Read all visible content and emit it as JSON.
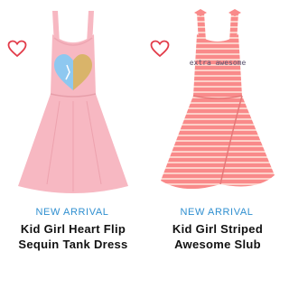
{
  "products": [
    {
      "badge": "NEW ARRIVAL",
      "title_line1": "Kid Girl Heart Flip",
      "title_line2": "Sequin Tank Dress",
      "dress_color": "#f7b8c2",
      "heart_colors": [
        "#8ec8f0",
        "#d9b46a"
      ],
      "icon": "heart-outline-icon"
    },
    {
      "badge": "NEW ARRIVAL",
      "title_line1": "Kid Girl Striped",
      "title_line2": "Awesome Slub",
      "dress_color": "#f98a8a",
      "stripe_color": "#fdd0c8",
      "print_text": "extra awesome",
      "icon": "heart-outline-icon"
    }
  ],
  "colors": {
    "accent_blue": "#2f8fd0",
    "heart_red": "#e23c4a"
  }
}
